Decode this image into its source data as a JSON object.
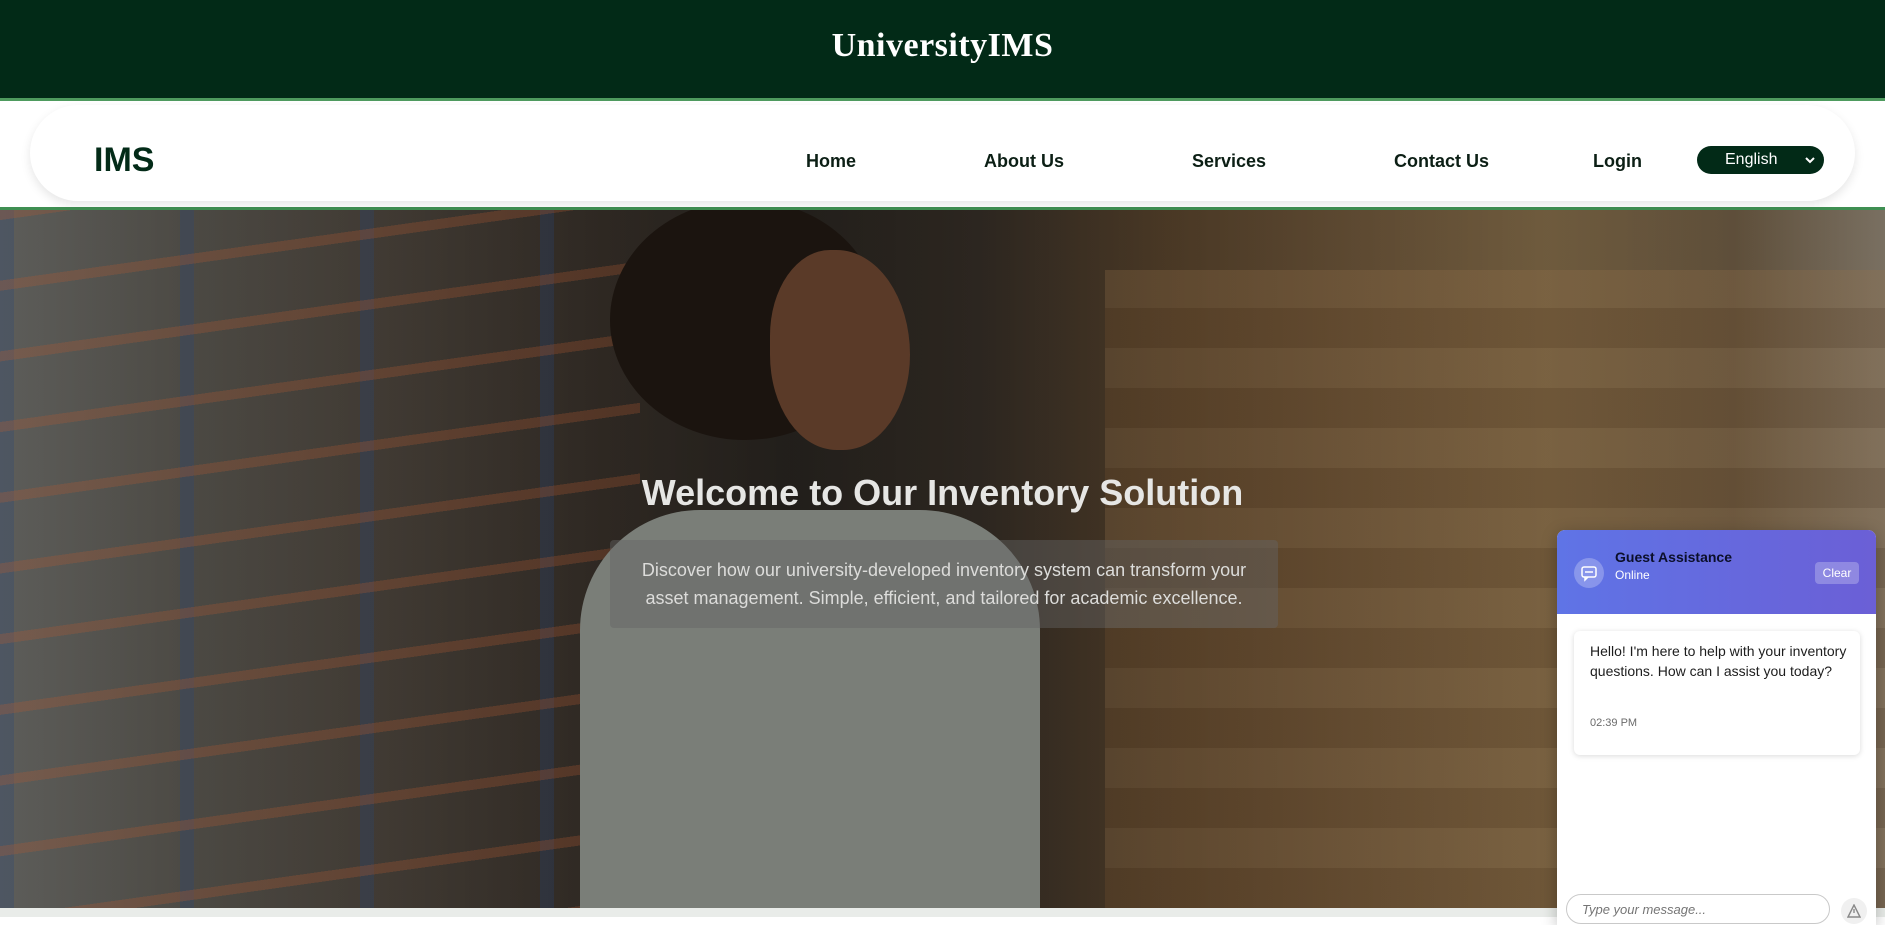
{
  "topbar": {
    "brand": "UniversityIMS"
  },
  "nav": {
    "logo": "IMS",
    "links": [
      "Home",
      "About Us",
      "Services",
      "Contact Us",
      "Login"
    ],
    "language": {
      "selected": "English"
    }
  },
  "hero": {
    "title": "Welcome to Our Inventory Solution",
    "subtitle": "Discover how our university-developed inventory system can transform your asset management. Simple, efficient, and tailored for academic excellence."
  },
  "chat": {
    "title": "Guest Assistance",
    "status": "Online",
    "clear_label": "Clear",
    "message": {
      "text": "Hello! I'm here to help with your inventory questions. How can I assist you today?",
      "time": "02:39 PM"
    },
    "input_placeholder": "Type your message...",
    "icons": {
      "avatar": "chat-bubble-icon",
      "send": "send-icon"
    }
  },
  "colors": {
    "topbar_bg": "#022a17",
    "accent_green": "#3f8f52",
    "chat_header_start": "#5f74e6",
    "chat_header_end": "#6b5fd6"
  }
}
